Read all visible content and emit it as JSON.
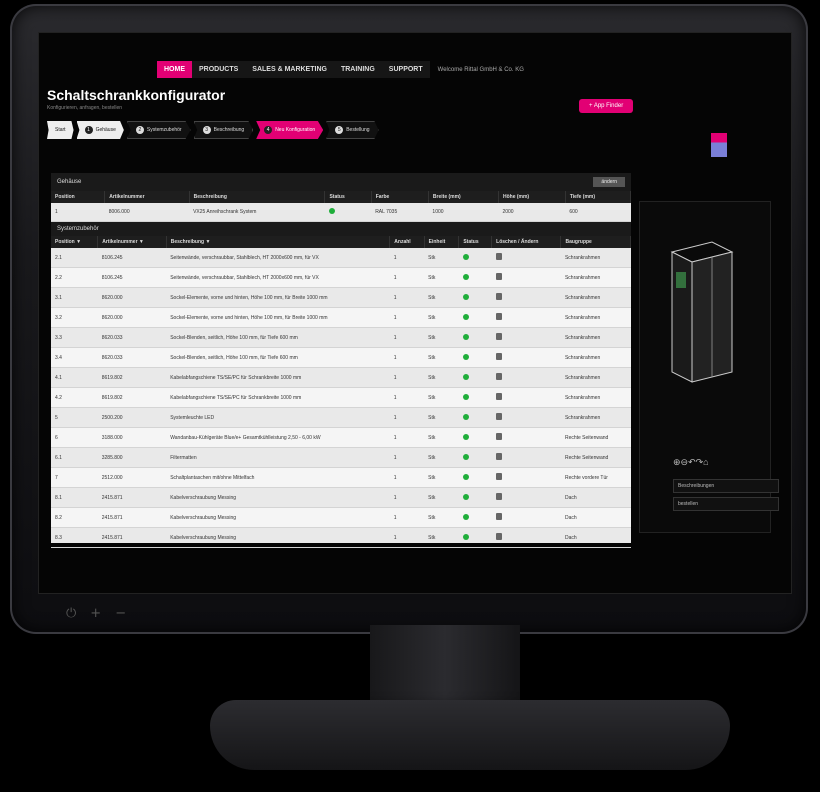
{
  "nav": {
    "items": [
      "HOME",
      "PRODUCTS",
      "SALES & MARKETING",
      "TRAINING",
      "SUPPORT"
    ],
    "welcome": "Welcome Rittal GmbH & Co. KG"
  },
  "app": {
    "title": "Schaltschrankkonfigurator",
    "subtitle": "Konfigurieren, anfragen, bestellen",
    "app_finder": "App Finder"
  },
  "steps": [
    {
      "label": "Start"
    },
    {
      "num": "1",
      "label": "Gehäuse"
    },
    {
      "num": "2",
      "label": "Systemzubehör"
    },
    {
      "num": "3",
      "label": "Beschreibung"
    },
    {
      "num": "4",
      "label": "Neu Konfiguration"
    },
    {
      "num": "5",
      "label": "Bestellung"
    }
  ],
  "gehaeuse": {
    "section_title": "Gehäuse",
    "button": "ändern",
    "columns": [
      "Position",
      "Artikelnummer",
      "Beschreibung",
      "Status",
      "Farbe",
      "Breite (mm)",
      "Höhe (mm)",
      "Tiefe (mm)"
    ],
    "rows": [
      {
        "pos": "1",
        "art": "8006.000",
        "desc": "VX25 Anreihschrank System",
        "color": "RAL 7035",
        "w": "1000",
        "h": "2000",
        "d": "600"
      }
    ]
  },
  "zubehoer": {
    "section_title": "Systemzubehör",
    "columns": [
      "Position ▼",
      "Artikelnummer ▼",
      "Beschreibung ▼",
      "Anzahl",
      "Einheit",
      "Status",
      "Löschen / Ändern",
      "Baugruppe"
    ],
    "rows": [
      {
        "pos": "2.1",
        "art": "8106.245",
        "desc": "Seitenwände, verschraubbar, Stahlblech, HT 2000x600 mm, für VX",
        "qty": "1",
        "unit": "Stk",
        "group": "Schrankrahmen"
      },
      {
        "pos": "2.2",
        "art": "8106.245",
        "desc": "Seitenwände, verschraubbar, Stahlblech, HT 2000x600 mm, für VX",
        "qty": "1",
        "unit": "Stk",
        "group": "Schrankrahmen"
      },
      {
        "pos": "3.1",
        "art": "8620.000",
        "desc": "Sockel-Elemente, vorne und hinten, Höhe 100 mm, für Breite 1000 mm",
        "qty": "1",
        "unit": "Stk",
        "group": "Schrankrahmen"
      },
      {
        "pos": "3.2",
        "art": "8620.000",
        "desc": "Sockel-Elemente, vorne und hinten, Höhe 100 mm, für Breite 1000 mm",
        "qty": "1",
        "unit": "Stk",
        "group": "Schrankrahmen"
      },
      {
        "pos": "3.3",
        "art": "8620.033",
        "desc": "Sockel-Blenden, seitlich, Höhe 100 mm, für Tiefe 600 mm",
        "qty": "1",
        "unit": "Stk",
        "group": "Schrankrahmen"
      },
      {
        "pos": "3.4",
        "art": "8620.033",
        "desc": "Sockel-Blenden, seitlich, Höhe 100 mm, für Tiefe 600 mm",
        "qty": "1",
        "unit": "Stk",
        "group": "Schrankrahmen"
      },
      {
        "pos": "4.1",
        "art": "8619.802",
        "desc": "Kabelabfangschiene TS/SE/PC für Schrankbreite 1000 mm",
        "qty": "1",
        "unit": "Stk",
        "group": "Schrankrahmen"
      },
      {
        "pos": "4.2",
        "art": "8619.802",
        "desc": "Kabelabfangschiene TS/SE/PC für Schrankbreite 1000 mm",
        "qty": "1",
        "unit": "Stk",
        "group": "Schrankrahmen"
      },
      {
        "pos": "5",
        "art": "2500.200",
        "desc": "Systemleuchte LED",
        "qty": "1",
        "unit": "Stk",
        "group": "Schrankrahmen"
      },
      {
        "pos": "6",
        "art": "3188.000",
        "desc": "Wandanbau-Kühlgeräte Blue/e+ Gesamtkühlleistung 2,50 - 6,00 kW",
        "qty": "1",
        "unit": "Stk",
        "group": "Rechte Seitenwand"
      },
      {
        "pos": "6.1",
        "art": "3285.800",
        "desc": "Filtermatten",
        "qty": "1",
        "unit": "Stk",
        "group": "Rechte Seitenwand"
      },
      {
        "pos": "7",
        "art": "2512.000",
        "desc": "Schaltplantaschen mit/ohne Mittelfach",
        "qty": "1",
        "unit": "Stk",
        "group": "Rechte vordere Tür"
      },
      {
        "pos": "8.1",
        "art": "2415.871",
        "desc": "Kabelverschraubung Messing",
        "qty": "1",
        "unit": "Stk",
        "group": "Dach"
      },
      {
        "pos": "8.2",
        "art": "2415.871",
        "desc": "Kabelverschraubung Messing",
        "qty": "1",
        "unit": "Stk",
        "group": "Dach"
      },
      {
        "pos": "8.3",
        "art": "2415.871",
        "desc": "Kabelverschraubung Messing",
        "qty": "1",
        "unit": "Stk",
        "group": "Dach"
      }
    ]
  },
  "side": {
    "links": [
      "Beschreibungen",
      "bestellen"
    ],
    "tool_icons": "⊕⊖↶↷⌂"
  },
  "bezel": {
    "controls": [
      "⏻",
      "+",
      "−"
    ]
  },
  "colors": {
    "accent": "#e20074",
    "status_ok": "#1fae3a"
  }
}
